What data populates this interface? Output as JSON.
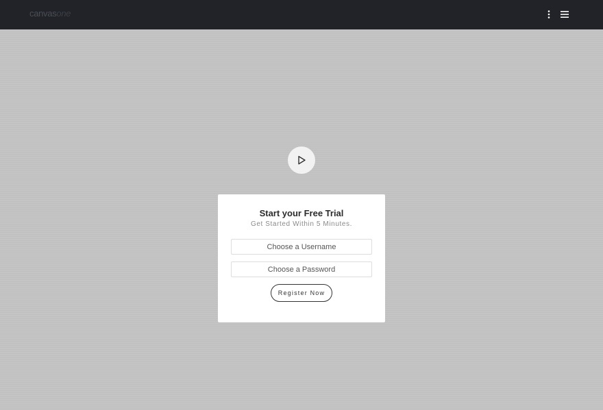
{
  "header": {
    "logo_main": "canvas",
    "logo_accent": "one",
    "menu_icon": "kebab-icon",
    "nav_icon": "hamburger-icon"
  },
  "hero": {
    "play_icon": "play-icon"
  },
  "signup": {
    "title": "Start your Free Trial",
    "subtitle": "Get Started Within 5 Minutes.",
    "username_placeholder": "Choose a Username",
    "password_placeholder": "Choose a Password",
    "register_label": "Register Now"
  },
  "colors": {
    "topbar": "#212328",
    "background": "#c2c2c2",
    "card": "#ffffff"
  }
}
